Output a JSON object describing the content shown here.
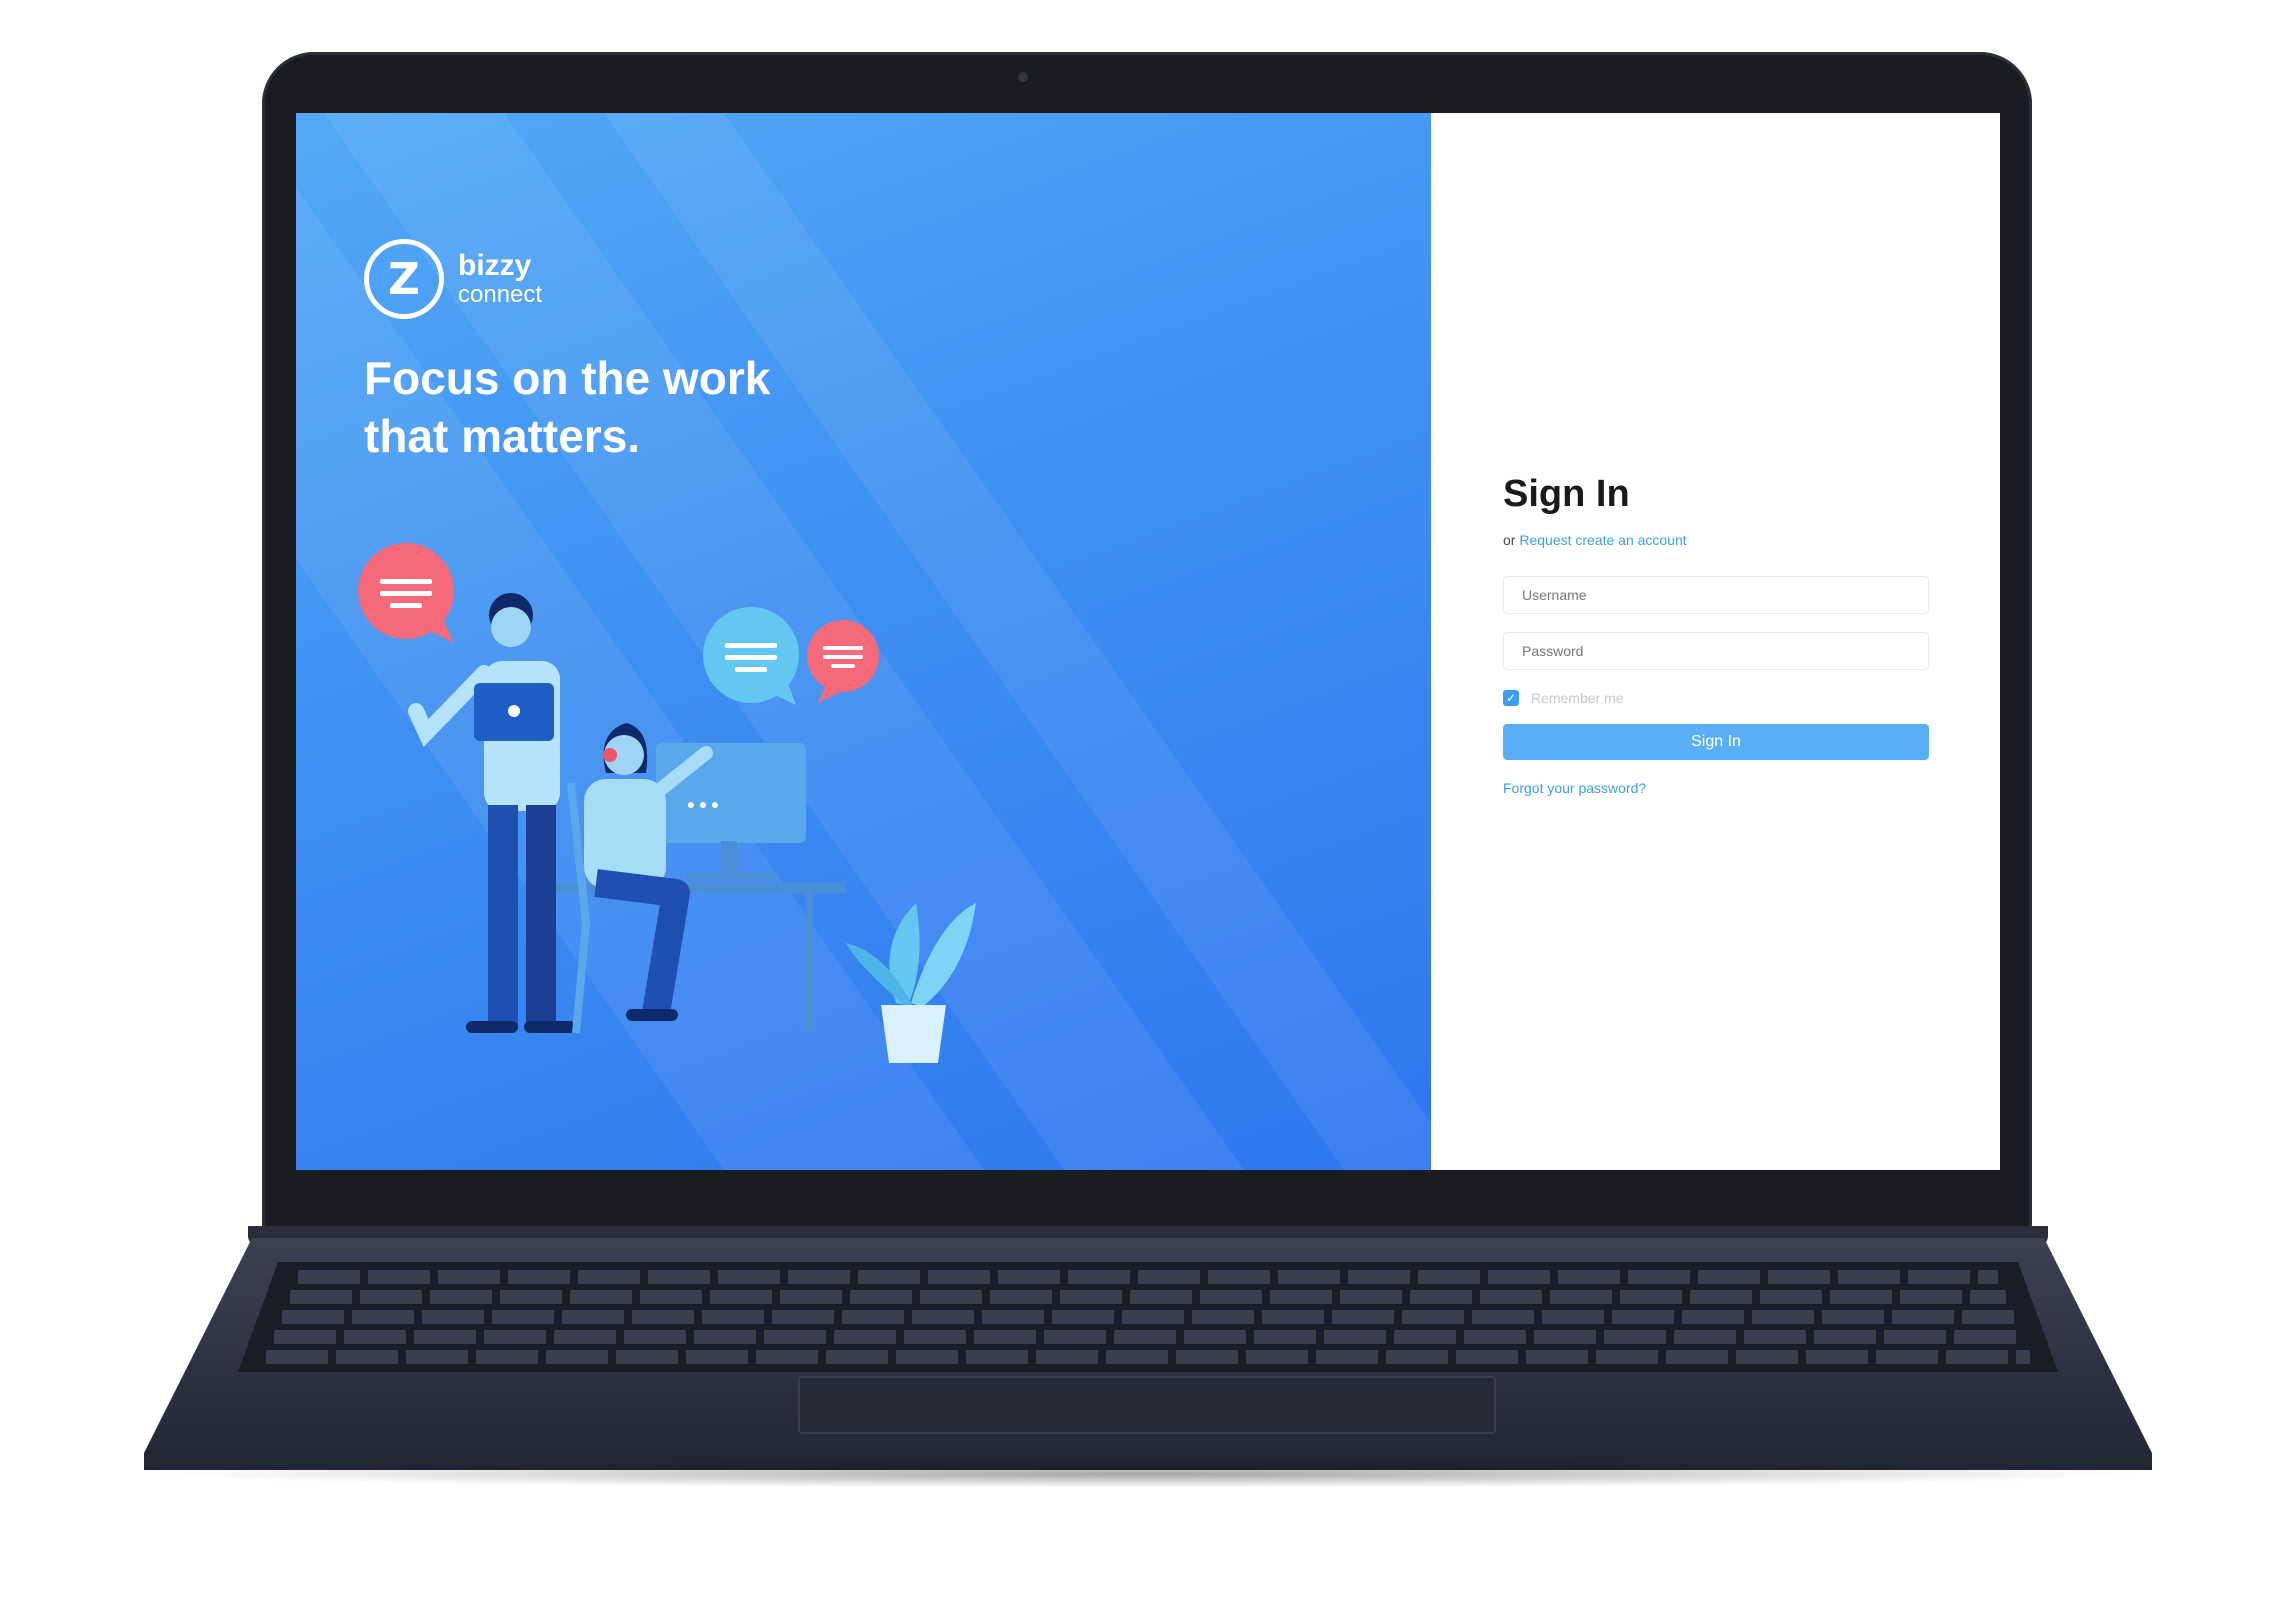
{
  "brand": {
    "logo_glyph": "Z",
    "name_line1": "bizzy",
    "name_line2": "connect"
  },
  "hero": {
    "headline_line1": "Focus on the work",
    "headline_line2": "that matters."
  },
  "signin": {
    "title": "Sign In",
    "or_text": "or",
    "request_link": "Request create an account",
    "username_placeholder": "Username",
    "password_placeholder": "Password",
    "remember_label": "Remember me",
    "remember_checked": true,
    "submit_label": "Sign In",
    "forgot_link": "Forgot your password?"
  },
  "colors": {
    "hero_gradient_start": "#53a9f7",
    "hero_gradient_end": "#2f76f0",
    "accent": "#3b9ef5",
    "button": "#5aaef6",
    "bubble_red": "#f46a7a",
    "bubble_blue": "#62c8f2"
  },
  "icons": {
    "logo": "bizzy-logo-icon",
    "checkbox": "check-icon",
    "chat_bubbles": "chat-bubble-icon"
  }
}
